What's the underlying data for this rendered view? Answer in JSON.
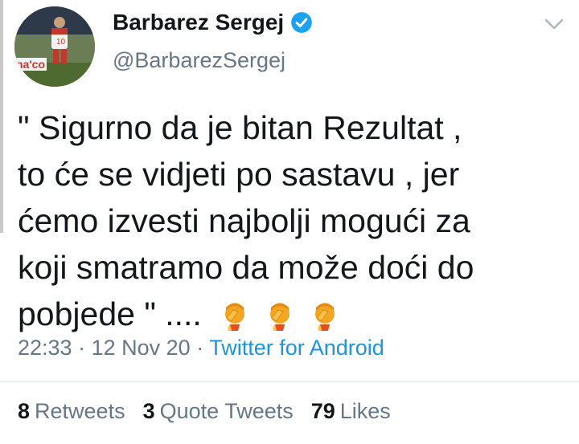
{
  "author": {
    "display_name": "Barbarez Sergej",
    "handle": "@BarbarezSergej",
    "verified": true,
    "avatar_text": "na'co"
  },
  "tweet": {
    "lines": [
      "\" Sigurno da je bitan Rezultat ,",
      "to će se vidjeti po sastavu , jer",
      "ćemo izvesti najbolji mogući za",
      "koji smatramo da može doći do",
      "pobjede \" ...."
    ],
    "emojis": [
      "face-palm-emoji",
      "face-palm-emoji",
      "face-palm-emoji"
    ]
  },
  "meta": {
    "time": "22:33",
    "separator": " · ",
    "date": "12 Nov 20",
    "source": "Twitter for Android"
  },
  "stats": {
    "retweets_count": "8",
    "retweets_label": "Retweets",
    "quotes_count": "3",
    "quotes_label": "Quote Tweets",
    "likes_count": "79",
    "likes_label": "Likes"
  },
  "colors": {
    "link": "#1b95e0",
    "secondary": "#657786",
    "primary": "#14171a"
  }
}
